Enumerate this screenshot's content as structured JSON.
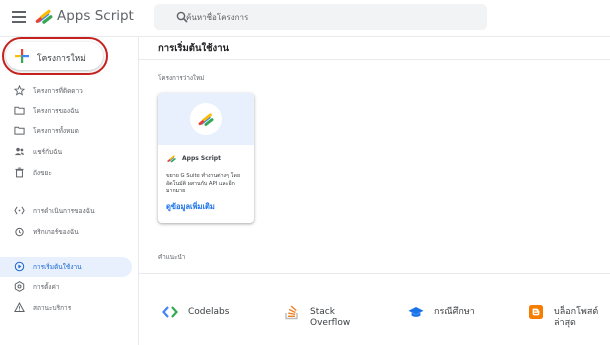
{
  "app": {
    "title": "Apps Script"
  },
  "search": {
    "placeholder": "ค้นหาชื่อโครงการ"
  },
  "sidebar": {
    "new_project_label": "โครงการใหม่",
    "items": [
      {
        "label": "โครงการที่ติดดาว",
        "icon": "star-icon"
      },
      {
        "label": "โครงการของฉัน",
        "icon": "folder-icon"
      },
      {
        "label": "โครงการทั้งหมด",
        "icon": "folder-icon"
      },
      {
        "label": "แชร์กับฉัน",
        "icon": "people-icon"
      },
      {
        "label": "ถังขยะ",
        "icon": "trash-icon"
      },
      {
        "label": "การดำเนินการของฉัน",
        "icon": "executions-icon"
      },
      {
        "label": "ทริกเกอร์ของฉัน",
        "icon": "alarm-icon"
      },
      {
        "label": "การเริ่มต้นใช้งาน",
        "icon": "play-circle-icon",
        "active": true
      },
      {
        "label": "การตั้งค่า",
        "icon": "settings-icon"
      },
      {
        "label": "สถานะบริการ",
        "icon": "warning-icon"
      }
    ]
  },
  "main": {
    "title": "การเริ่มต้นใช้งาน",
    "blank_projects_heading": "โครงการว่างใหม่",
    "card": {
      "name": "Apps Script",
      "description": "ขยาย G Suite ทำงานต่างๆ โดยอัตโนมัติ ผสานกับ API และอีกมากมาย",
      "link": "ดูข้อมูลเพิ่มเติม"
    },
    "resources_heading": "คำแนะนำ",
    "resources": [
      {
        "label": "Codelabs",
        "icon": "codelabs-icon"
      },
      {
        "label": "Stack Overflow",
        "icon": "stack-overflow-icon"
      },
      {
        "label": "กรณีศึกษา",
        "icon": "graduation-cap-icon"
      },
      {
        "label": "บล็อกโพสต์ล่าสุด",
        "icon": "blogger-icon"
      }
    ]
  },
  "colors": {
    "accent": "#1a73e8",
    "highlight_ring": "#c5221f",
    "active_bg": "#e8f0fe"
  }
}
